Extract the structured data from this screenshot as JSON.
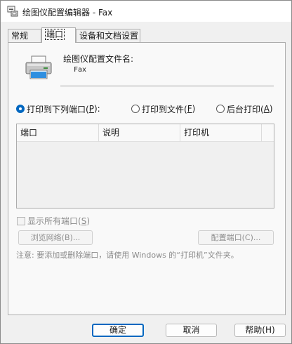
{
  "window": {
    "title": "绘图仪配置编辑器 - Fax"
  },
  "tabs": [
    {
      "label": "常规"
    },
    {
      "label": "端口"
    },
    {
      "label": "设备和文档设置"
    }
  ],
  "config": {
    "label": "绘图仪配置文件名:",
    "filename": "Fax"
  },
  "radios": {
    "list": {
      "label": "打印到下列端口(",
      "key": "P",
      "end": "):",
      "checked": true
    },
    "file": {
      "label": "打印到文件(",
      "key": "F",
      "end": ")",
      "checked": false
    },
    "background": {
      "label": "后台打印(",
      "key": "A",
      "end": ")",
      "checked": false
    }
  },
  "listview": {
    "columns": [
      "端口",
      "说明",
      "打印机",
      ""
    ],
    "rows": []
  },
  "show_all_ports": {
    "label": "显示所有端口(",
    "key": "S",
    "end": ")",
    "checked": false
  },
  "buttons": {
    "browse": "浏览网络(B)...",
    "configure": "配置端口(C)...",
    "ok": "确定",
    "cancel": "取消",
    "help": "帮助(H)"
  },
  "note": "注意: 要添加或删除端口，请使用 Windows 的“打印机”文件夹。",
  "colors": {
    "accent": "#0067c0",
    "disabled_text": "#8a8a8a"
  }
}
